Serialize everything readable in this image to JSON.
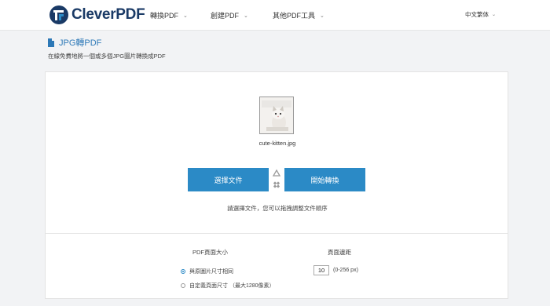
{
  "brand": {
    "name": "CleverPDF"
  },
  "nav": [
    {
      "label": "轉換PDF"
    },
    {
      "label": "創建PDF"
    },
    {
      "label": "其他PDF工具"
    }
  ],
  "language": {
    "label": "中文繁体"
  },
  "page": {
    "title": "JPG轉PDF",
    "subtitle": "在線免費地將一個或多個JPG圖片轉換成PDF"
  },
  "upload": {
    "file_name": "cute-kitten.jpg",
    "choose_label": "選擇文件",
    "start_label": "開始轉換",
    "hint": "請選擇文件，您可以拖拽調整文件順序"
  },
  "options": {
    "page_size_header": "PDF頁面大小",
    "page_size_options": [
      {
        "label": "與原圖片尺寸相同",
        "selected": true
      },
      {
        "label": "自定義頁面尺寸 （最大1280像素）",
        "selected": false
      }
    ],
    "margin_header": "頁面邊距",
    "margin_value": "10",
    "margin_range": "(0-256 px)"
  },
  "colors": {
    "accent": "#2b8ac6",
    "brand": "#1a3a66"
  }
}
